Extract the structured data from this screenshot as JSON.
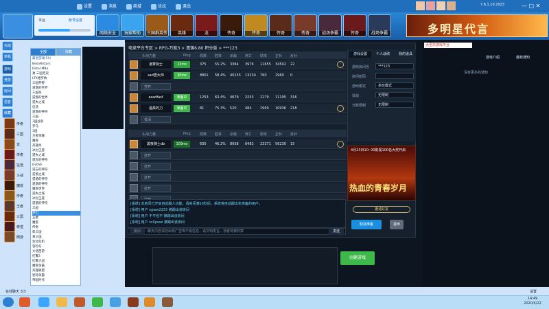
{
  "topbar": {
    "items": [
      "设置",
      "消息",
      "商城",
      "论坛",
      "退出"
    ],
    "version": "7.6.1.10.2023"
  },
  "banner": {
    "icons": [
      "网络安全",
      "玩家帮助",
      "三国群英传",
      "英雄",
      "龙",
      "传奇",
      "传奇",
      "传奇",
      "传奇",
      "战场争霸"
    ],
    "ad_text": "多明星代言"
  },
  "userbox": {
    "title": "平台",
    "link": "账号设置",
    "progress": 0.6
  },
  "left_tabs": [
    "对战",
    "单机",
    "游戏",
    "竞技",
    "房间",
    "语音",
    "收藏",
    "网游"
  ],
  "left_games": [
    "传奇",
    "三国",
    "龙",
    "传奇",
    "征途",
    "斗战",
    "魔兽",
    "传奇",
    "王者",
    "三国",
    "奇迹",
    "网游"
  ],
  "tree": {
    "tabs": [
      "全部",
      "收藏"
    ],
    "header": "最近游戏(50)",
    "items": [
      "BestAllstars",
      "Dota IMBa",
      "真·三国无双",
      "LTX维罗纳",
      "三国开野",
      "遗落的世界",
      "三国杀",
      "遗落的世界",
      "遗失之城",
      "征途",
      "遗落的神符",
      "三国",
      "3国战争",
      "罗马",
      "3国",
      "王者荣耀",
      "魔兽",
      "英雄杀",
      "冰封王座",
      "遗失之城",
      "遗忘的神符",
      "DotA6",
      "遗忘的神符",
      "遗落之城",
      "遗落的神符",
      "遗落的神符",
      "魔兽世界",
      "遗失之城",
      "冰封王座",
      "遗落的神符",
      "三国",
      "梦幻",
      "王者",
      "魔兽",
      "传奇",
      "新三国",
      "真三国",
      "生化危机",
      "冒险岛",
      "大话西游",
      "红警2",
      "红警大战",
      "魔兽争霸",
      "英雄联盟",
      "星际争霸",
      "帝国时代"
    ],
    "selected_index": 31
  },
  "room": {
    "title": "电竞平台专区 > RPG-万能3 > 遗落6.80 积分版 > ***123"
  },
  "team1": {
    "headers": [
      "头衔力量",
      "Ping",
      "局数",
      "胜率",
      "杀敌",
      "死亡",
      "助攻",
      "正补",
      "反补"
    ],
    "rows": [
      {
        "name": "凌霄剑士",
        "ping": "23ms",
        "ping_color": "#2fa83a",
        "games": "375",
        "winrate": "55.2%",
        "kills": "3364",
        "deaths": "3976",
        "assists": "11655",
        "lh": "34502",
        "dn": "22"
      },
      {
        "name": "sad雪大帅",
        "ping": "30ms",
        "ping_color": "#3fb84a",
        "games": "8801",
        "winrate": "58.4%",
        "kills": "40155",
        "deaths": "13234",
        "assists": "760",
        "lh": "2969",
        "dn": "0"
      },
      {
        "name": "打开",
        "empty": true
      },
      {
        "name": "asadfasf",
        "ping": "准备中",
        "ping_color": "#3fb84a",
        "games": "1253",
        "winrate": "63.4%",
        "kills": "4679",
        "deaths": "2253",
        "assists": "2279",
        "lh": "11195",
        "dn": "316"
      },
      {
        "name": "温柔的刀",
        "ping": "准备中",
        "ping_color": "#3fb84a",
        "games": "81",
        "winrate": "75.3%",
        "kills": "520",
        "deaths": "484",
        "assists": "1969",
        "lh": "10936",
        "dn": "218"
      },
      {
        "name": "关闭",
        "empty": true
      }
    ]
  },
  "team2": {
    "headers": [
      "头衔力量",
      "Ping",
      "局数",
      "胜率",
      "杀敌",
      "死亡",
      "助攻",
      "正补",
      "反补"
    ],
    "rows": [
      {
        "name": "黑夜骑士db",
        "ping": "109ms",
        "ping_color": "#1a6e28",
        "games": "600",
        "winrate": "46.2%",
        "kills": "8938",
        "deaths": "6482",
        "assists": "23371",
        "lh": "56230",
        "dn": "15"
      },
      {
        "name": "打开",
        "empty": true
      },
      {
        "name": "打开",
        "empty": true
      },
      {
        "name": "打开",
        "empty": true
      },
      {
        "name": "打开",
        "empty": true
      },
      {
        "name": "打开",
        "empty": true
      }
    ]
  },
  "settings": {
    "tabs": [
      "游戏设置",
      "个人战绩",
      "我的道具"
    ],
    "fields": [
      {
        "label": "游戏房间名",
        "value": "***123"
      },
      {
        "label": "房间密码",
        "value": ""
      },
      {
        "label": "游戏模式",
        "value": "多玩模式"
      },
      {
        "label": "观战",
        "value": "无限制"
      },
      {
        "label": "分数限制",
        "value": "无限制"
      }
    ]
  },
  "ad2": {
    "line1": "4月23日10: 00影视100名大奖开启",
    "line2": "热血的青春岁月"
  },
  "actions": {
    "invite": "邀请好友",
    "cancel_ready": "取消准备",
    "leave": "退出"
  },
  "log": [
    "[系统] 本房间已开启自动踢人功能，请房间满10秒后，系统将自动踢出未准备的用户。",
    "[系统] 用户 xgww2233 被踢出该房间",
    "[系统] 用户 不平也不 被踢出该房间",
    "[系统] 用户 xclipsee 被踢出该房间"
  ],
  "chat": {
    "scope": "房间",
    "placeholder": "聊天内容请勿出现广告等不良信息，请文明发言，违者将被封禁",
    "send": "发送"
  },
  "create_game": "创建游戏",
  "right": {
    "search_value": "大圣宗游戏平台",
    "tabs": [
      "游戏介绍",
      "最新通知"
    ],
    "notice": "没有更多的通知"
  },
  "chatbar": {
    "text": "在线聊天 3/3",
    "right": "设置"
  },
  "clock": {
    "time": "14:49",
    "date": "2020/4/22"
  }
}
